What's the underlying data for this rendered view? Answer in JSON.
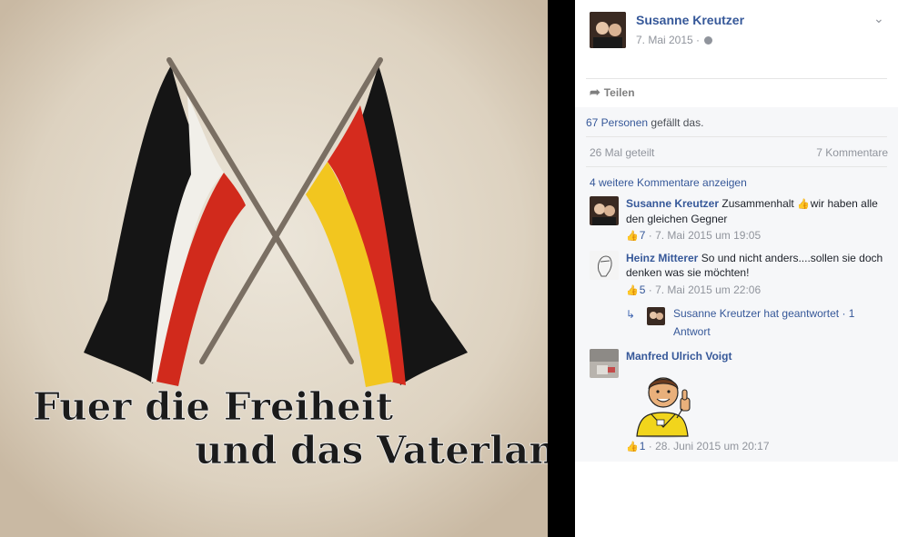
{
  "photo": {
    "caption_line1": "Fuer die Freiheit",
    "caption_line2": "und das Vaterland"
  },
  "post": {
    "author": "Susanne Kreutzer",
    "date": "7. Mai 2015",
    "share_label": "Teilen",
    "likes_link": "67 Personen",
    "likes_suffix": " gefällt das.",
    "shares": "26 Mal geteilt",
    "comments_count": "7 Kommentare",
    "more_comments": "4 weitere Kommentare anzeigen"
  },
  "comments": [
    {
      "author": "Susanne Kreutzer",
      "text_before": "Zusammenhalt ",
      "text_after": "wir haben alle den gleichen Gegner",
      "likes": "7",
      "time": "7. Mai 2015 um 19:05"
    },
    {
      "author": "Heinz Mitterer",
      "text": "So und nicht anders....sollen sie doch denken was sie möchten!",
      "likes": "5",
      "time": "7. Mai 2015 um 22:06",
      "reply_text": "Susanne Kreutzer hat geantwortet · 1 Antwort"
    },
    {
      "author": "Manfred Ulrich Voigt",
      "likes": "1",
      "time": "28. Juni 2015 um 20:17"
    }
  ],
  "colors": {
    "link": "#365899",
    "meta_gray": "#90949c",
    "panel_bg": "#f6f7f9",
    "like_blue": "#5890ff"
  },
  "icons": {
    "share": "share-arrow-icon",
    "audience": "globe-icon",
    "menu": "chevron-down-icon",
    "like": "thumbs-up-icon",
    "reply": "reply-arrow-icon"
  }
}
